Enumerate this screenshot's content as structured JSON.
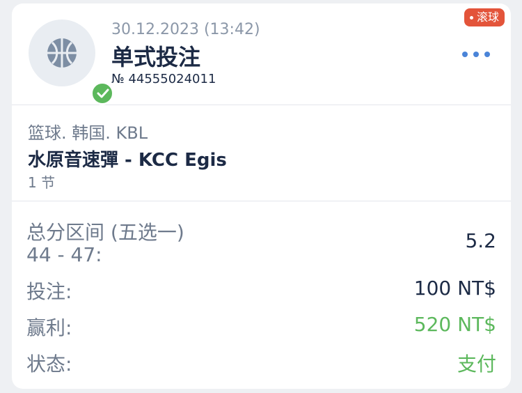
{
  "header": {
    "date": "30.12.2023 (13:42)",
    "title": "单式投注",
    "bet_number": "№ 44555024011",
    "live_badge": "滚球",
    "sport_icon": "basketball-icon",
    "status_icon": "check-icon",
    "menu_icon": "more-dots-icon"
  },
  "event": {
    "league": "篮球. 韩国. KBL",
    "match": "水原音速彈 - KCC Egis",
    "period": "1 节"
  },
  "details": {
    "market_label": "总分区间 (五选一)",
    "market_selection": "44 - 47:",
    "odds": "5.2",
    "stake_label": "投注:",
    "stake_value": "100 NT$",
    "win_label": "赢利:",
    "win_value": "520 NT$",
    "status_label": "状态:",
    "status_value": "支付"
  },
  "colors": {
    "accent": "#4a84d8",
    "success": "#5cb85c",
    "live": "#e3543a",
    "text_dark": "#1c2a45",
    "text_muted": "#6e7a8c"
  }
}
